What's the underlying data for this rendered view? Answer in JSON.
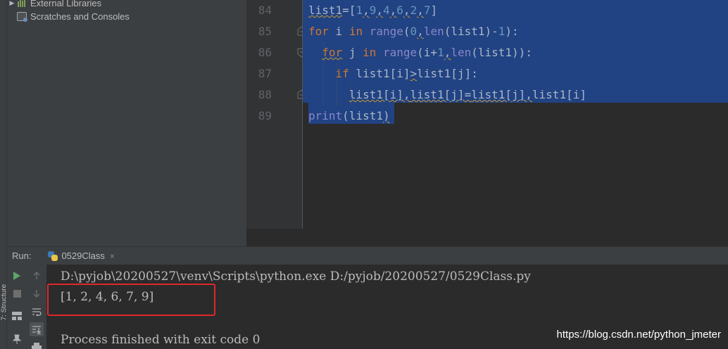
{
  "project_tree": {
    "items": [
      {
        "label": "External Libraries",
        "icon": "library-icon"
      },
      {
        "label": "Scratches and Consoles",
        "icon": "scratches-icon"
      }
    ]
  },
  "editor": {
    "line_numbers": [
      "84",
      "85",
      "86",
      "87",
      "88",
      "89"
    ],
    "lines": [
      [
        {
          "t": "list1",
          "c": "id",
          "w": true
        },
        {
          "t": "=[",
          "c": "id"
        },
        {
          "t": "1",
          "c": "num"
        },
        {
          "t": ",",
          "c": "id",
          "w": true
        },
        {
          "t": "9",
          "c": "num"
        },
        {
          "t": ",",
          "c": "id",
          "w": true
        },
        {
          "t": "4",
          "c": "num"
        },
        {
          "t": ",",
          "c": "id",
          "w": true
        },
        {
          "t": "6",
          "c": "num"
        },
        {
          "t": ",",
          "c": "id",
          "w": true
        },
        {
          "t": "2",
          "c": "num"
        },
        {
          "t": ",",
          "c": "id",
          "w": true
        },
        {
          "t": "7",
          "c": "num"
        },
        {
          "t": "]",
          "c": "id"
        }
      ],
      [
        {
          "t": "for",
          "c": "kw"
        },
        {
          "t": " i ",
          "c": "id"
        },
        {
          "t": "in",
          "c": "kw"
        },
        {
          "t": " ",
          "c": "id"
        },
        {
          "t": "range",
          "c": "fn"
        },
        {
          "t": "(",
          "c": "id"
        },
        {
          "t": "0",
          "c": "num"
        },
        {
          "t": ",",
          "c": "id",
          "w": true
        },
        {
          "t": "len",
          "c": "fn"
        },
        {
          "t": "(list1)-",
          "c": "id"
        },
        {
          "t": "1",
          "c": "num"
        },
        {
          "t": "):",
          "c": "id"
        }
      ],
      [
        {
          "t": "  ",
          "c": "id"
        },
        {
          "t": "for",
          "c": "kw",
          "w": true
        },
        {
          "t": " j ",
          "c": "id"
        },
        {
          "t": "in",
          "c": "kw"
        },
        {
          "t": " ",
          "c": "id"
        },
        {
          "t": "range",
          "c": "fn"
        },
        {
          "t": "(i+",
          "c": "id"
        },
        {
          "t": "1",
          "c": "num"
        },
        {
          "t": ",",
          "c": "id",
          "w": true
        },
        {
          "t": "len",
          "c": "fn"
        },
        {
          "t": "(list1)):",
          "c": "id"
        }
      ],
      [
        {
          "t": "    ",
          "c": "id"
        },
        {
          "t": "if",
          "c": "kw"
        },
        {
          "t": " list1[i]",
          "c": "id"
        },
        {
          "t": ">",
          "c": "id",
          "w": true
        },
        {
          "t": "list1[j]:",
          "c": "id"
        }
      ],
      [
        {
          "t": "      ",
          "c": "id"
        },
        {
          "t": "list1[i]",
          "c": "id",
          "w": true
        },
        {
          "t": ",",
          "c": "id",
          "w": true
        },
        {
          "t": "list1[j]",
          "c": "id",
          "w": true
        },
        {
          "t": "=",
          "c": "id",
          "w": true
        },
        {
          "t": "list1[j]",
          "c": "id",
          "w": true
        },
        {
          "t": ",",
          "c": "id",
          "w": true
        },
        {
          "t": "list1[i]",
          "c": "id"
        }
      ],
      [
        {
          "t": "print",
          "c": "fn"
        },
        {
          "t": "(list1",
          "c": "id"
        },
        {
          "t": ")",
          "c": "id",
          "w": true
        }
      ]
    ],
    "selection_color": "#214283"
  },
  "run_window": {
    "label": "Run:",
    "tab_label": "0529Class",
    "tab_close": "×",
    "structure_label": "7: Structure",
    "console_lines": [
      "D:\\pyjob\\20200527\\venv\\Scripts\\python.exe D:/pyjob/20200527/0529Class.py",
      "[1, 2, 4, 6, 7, 9]",
      "",
      "Process finished with exit code 0"
    ]
  },
  "watermark": "https://blog.csdn.net/python_jmeter",
  "colors": {
    "background": "#2b2b2b",
    "panel": "#3c3f41",
    "keyword": "#cc7832",
    "number": "#6897bb",
    "builtin": "#8888c6",
    "highlight_box": "#e0272b",
    "run_green": "#59a869"
  }
}
